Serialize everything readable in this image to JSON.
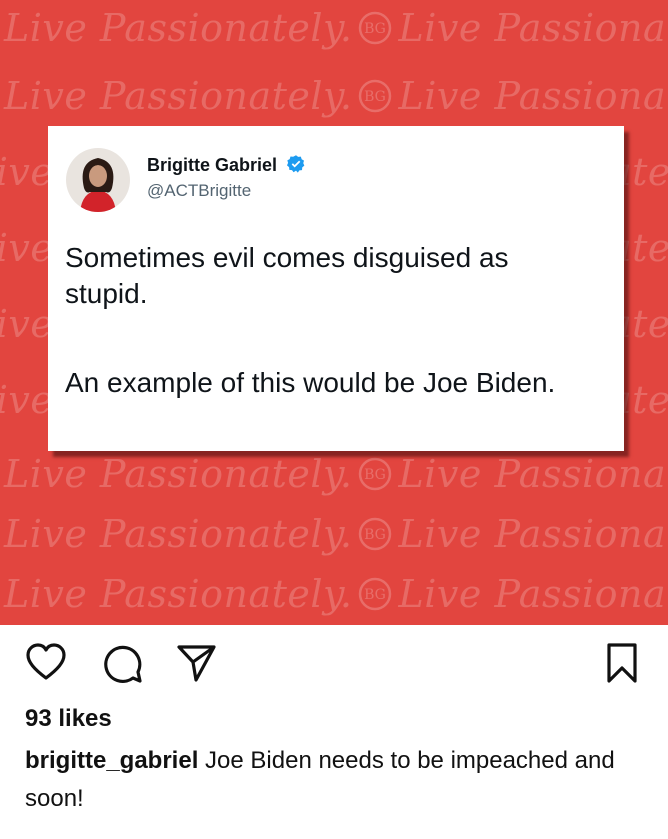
{
  "post": {
    "image": {
      "background_color": "#e2453f",
      "watermark": {
        "text": "Live Passionately.",
        "seal_text": "BG"
      },
      "tweet": {
        "author_name": "Brigitte Gabriel",
        "author_handle": "@ACTBrigitte",
        "verified": true,
        "verified_color": "#1d9bf0",
        "text_paragraph_1": "Sometimes evil comes disguised as stupid.",
        "text_paragraph_2": "An example of this would be Joe Biden."
      }
    },
    "actions": {
      "like_icon": "heart-icon",
      "comment_icon": "comment-icon",
      "share_icon": "send-icon",
      "save_icon": "bookmark-icon"
    },
    "likes": "93 likes",
    "caption": {
      "username": "brigitte_gabriel",
      "text": "Joe Biden needs to be impeached and soon!"
    }
  }
}
